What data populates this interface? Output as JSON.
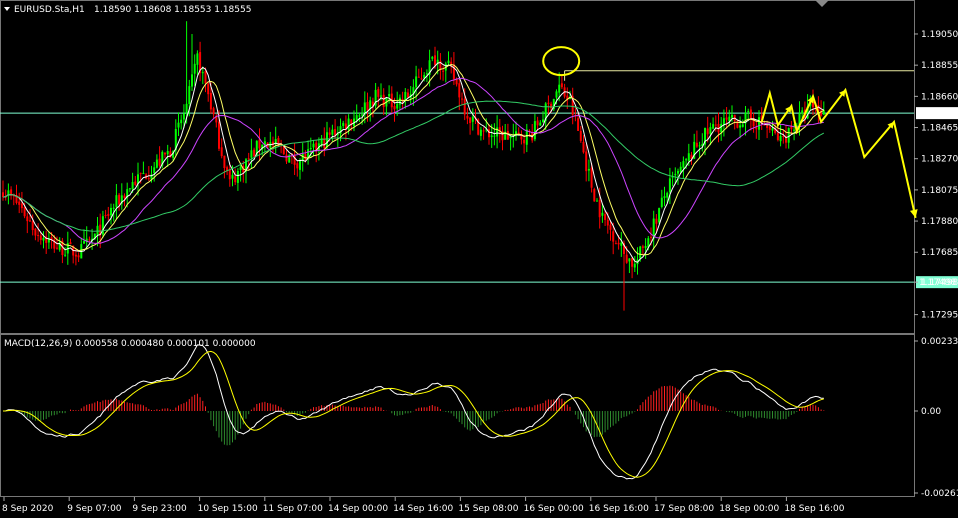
{
  "header": {
    "symbol": "EURUSD.Sta,H1",
    "ohlc": "1.18590 1.18608 1.18553 1.18555",
    "macd_label": "MACD(12,26,9) 0.000558 0.000480 0.000101 0.000000"
  },
  "colors": {
    "background": "#000000",
    "bull": "#00ff00",
    "bear": "#ff0000",
    "ma_fast": "#ffffff",
    "ma_mid": "#ffff66",
    "ma_slow": "#cc44ff",
    "ma_long": "#33cc66",
    "hline": "#7fffd4",
    "forecast": "#ffff00",
    "macd_main": "#ffffff",
    "macd_signal": "#ffff00",
    "hist_pos": "#ff2020",
    "hist_neg": "#2e8b2e"
  },
  "chart_data": {
    "type": "candlestick",
    "price_axis": {
      "ticks": [
        "1.19050",
        "1.18855",
        "1.18660",
        "1.18465",
        "1.18270",
        "1.18075",
        "1.17880",
        "1.17685",
        "1.17498",
        "1.17295"
      ],
      "range": [
        1.1718,
        1.1925
      ]
    },
    "macd_axis": {
      "ticks": [
        "0.002334",
        "0.00",
        "-0.00261"
      ],
      "range": [
        -0.00261,
        0.002334
      ]
    },
    "time_ticks": [
      "8 Sep 2020",
      "9 Sep 07:00",
      "9 Sep 23:00",
      "10 Sep 15:00",
      "11 Sep 07:00",
      "14 Sep 00:00",
      "14 Sep 16:00",
      "15 Sep 08:00",
      "16 Sep 00:00",
      "16 Sep 16:00",
      "17 Sep 08:00",
      "18 Sep 00:00",
      "18 Sep 16:00"
    ],
    "current_price": {
      "label": "1.18555",
      "value": 1.18555
    },
    "horizontal_lines": [
      {
        "label": "1.17498",
        "value": 1.17498
      },
      {
        "label": "",
        "value": 1.18555
      },
      {
        "label": "",
        "value": 1.1882
      }
    ],
    "close_path": [
      [
        0,
        1.1808
      ],
      [
        6,
        1.1798
      ],
      [
        12,
        1.1782
      ],
      [
        20,
        1.1772
      ],
      [
        28,
        1.1768
      ],
      [
        34,
        1.1778
      ],
      [
        40,
        1.1795
      ],
      [
        48,
        1.1812
      ],
      [
        56,
        1.1822
      ],
      [
        62,
        1.1832
      ],
      [
        68,
        1.186
      ],
      [
        72,
        1.189
      ],
      [
        76,
        1.1868
      ],
      [
        80,
        1.1838
      ],
      [
        84,
        1.1812
      ],
      [
        90,
        1.1825
      ],
      [
        96,
        1.1838
      ],
      [
        102,
        1.1834
      ],
      [
        108,
        1.1825
      ],
      [
        114,
        1.183
      ],
      [
        120,
        1.184
      ],
      [
        126,
        1.1848
      ],
      [
        132,
        1.1856
      ],
      [
        138,
        1.1866
      ],
      [
        144,
        1.1862
      ],
      [
        150,
        1.1866
      ],
      [
        156,
        1.1882
      ],
      [
        160,
        1.189
      ],
      [
        166,
        1.1882
      ],
      [
        172,
        1.1855
      ],
      [
        178,
        1.1843
      ],
      [
        184,
        1.1842
      ],
      [
        190,
        1.184
      ],
      [
        196,
        1.1843
      ],
      [
        202,
        1.186
      ],
      [
        206,
        1.1872
      ],
      [
        210,
        1.1862
      ],
      [
        214,
        1.1838
      ],
      [
        218,
        1.181
      ],
      [
        222,
        1.179
      ],
      [
        226,
        1.178
      ],
      [
        230,
        1.1768
      ],
      [
        234,
        1.176
      ],
      [
        238,
        1.1775
      ],
      [
        242,
        1.179
      ],
      [
        246,
        1.1808
      ],
      [
        252,
        1.1822
      ],
      [
        258,
        1.1838
      ],
      [
        264,
        1.1848
      ],
      [
        270,
        1.185
      ],
      [
        276,
        1.1852
      ],
      [
        282,
        1.1848
      ],
      [
        288,
        1.1838
      ],
      [
        294,
        1.185
      ],
      [
        300,
        1.186
      ],
      [
        304,
        1.18555
      ]
    ],
    "candle_count": 305,
    "moving_averages": [
      {
        "period": 5,
        "color_key": "ma_fast"
      },
      {
        "period": 10,
        "color_key": "ma_mid"
      },
      {
        "period": 24,
        "color_key": "ma_slow"
      },
      {
        "period": 60,
        "color_key": "ma_long"
      }
    ],
    "macd": {
      "fast": 12,
      "slow": 26,
      "signal": 9
    },
    "annotations": {
      "circle": {
        "bar": 206,
        "price": 1.1888
      },
      "forecast_zigzag": [
        {
          "bar": 281,
          "price": 1.185
        },
        {
          "bar": 284,
          "price": 1.1868
        },
        {
          "bar": 287,
          "price": 1.1848
        },
        {
          "bar": 292,
          "price": 1.186
        },
        {
          "bar": 294,
          "price": 1.1844
        },
        {
          "bar": 300,
          "price": 1.1866
        },
        {
          "bar": 303,
          "price": 1.185
        },
        {
          "bar": 312,
          "price": 1.187
        },
        {
          "bar": 319,
          "price": 1.1828
        },
        {
          "bar": 330,
          "price": 1.185
        },
        {
          "bar": 338,
          "price": 1.179
        }
      ]
    }
  }
}
